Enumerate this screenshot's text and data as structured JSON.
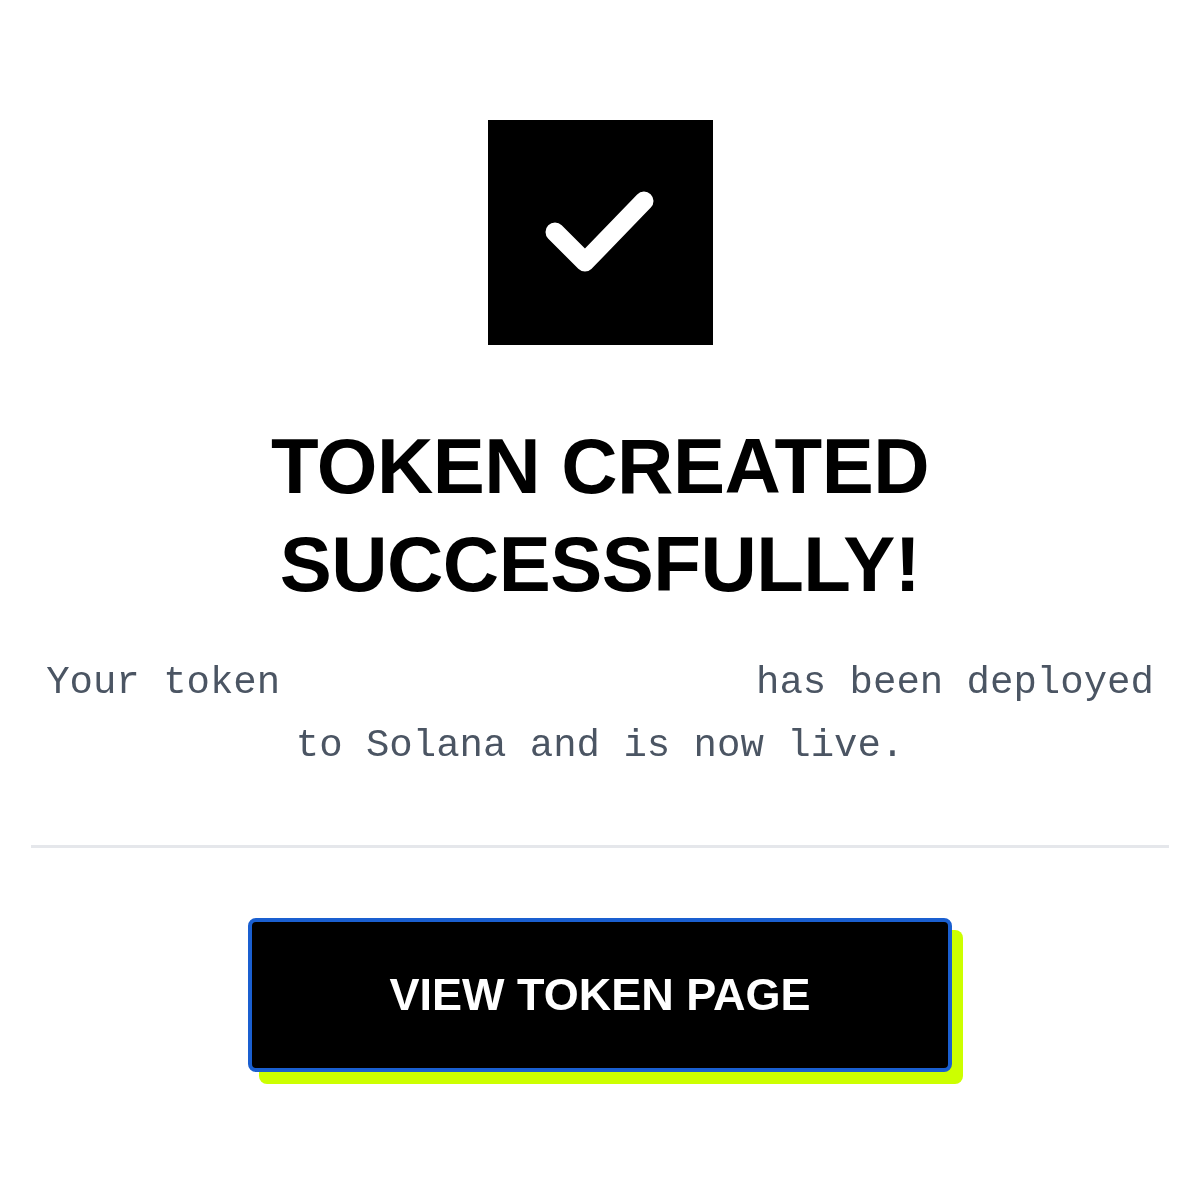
{
  "title": "TOKEN CREATED SUCCESSFULLY!",
  "message": {
    "before": "Your token",
    "after": "has been deployed to Solana and is now live."
  },
  "button": {
    "label": "VIEW TOKEN PAGE",
    "focused": true
  }
}
